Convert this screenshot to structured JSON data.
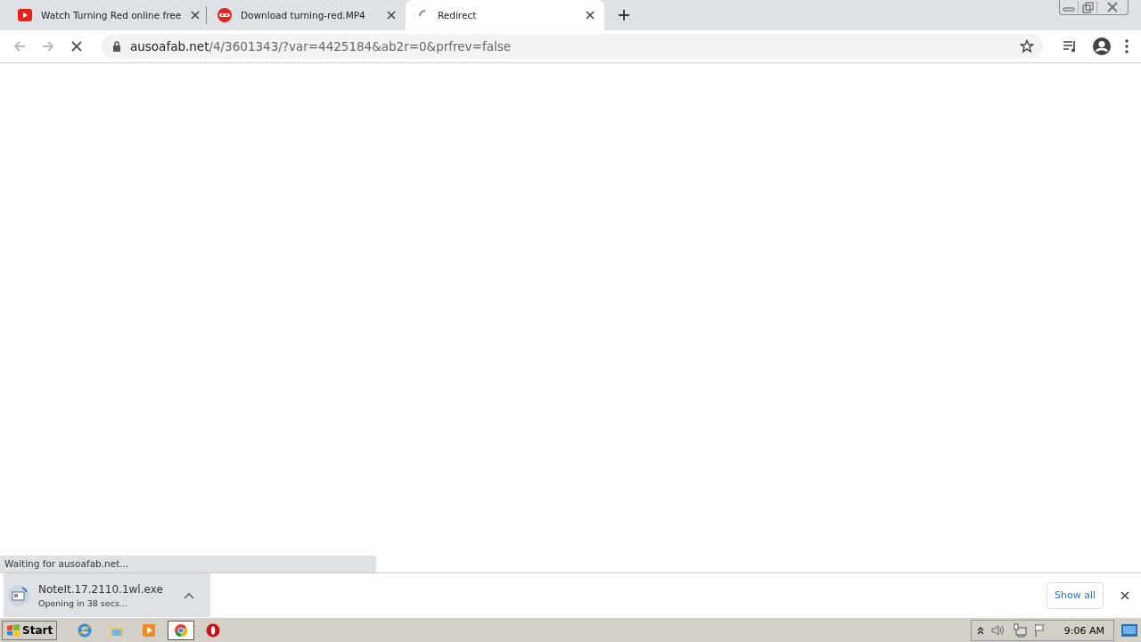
{
  "tabs": [
    {
      "title": "Watch Turning Red online free",
      "selected": false,
      "kind": "video"
    },
    {
      "title": "Download turning-red.MP4",
      "selected": false,
      "kind": "mask"
    },
    {
      "title": "Redirect",
      "selected": true,
      "kind": "loading"
    }
  ],
  "address": {
    "host": "ausoafab.net",
    "path": "/4/3601343/?var=4425184&ab2r=0&prfrev=false"
  },
  "status_text": "Waiting for ausoafab.net...",
  "download": {
    "filename": "NoteIt.17.2110.1wl.exe",
    "status": "Opening in 38 secs..."
  },
  "show_all": "Show all",
  "taskbar": {
    "start": "Start",
    "apps": [
      {
        "kind": "ie",
        "selected": false
      },
      {
        "kind": "folder",
        "selected": false
      },
      {
        "kind": "media",
        "selected": false
      },
      {
        "kind": "chrome",
        "selected": true
      },
      {
        "kind": "opera",
        "selected": false
      }
    ],
    "clock": "9:06 AM"
  }
}
